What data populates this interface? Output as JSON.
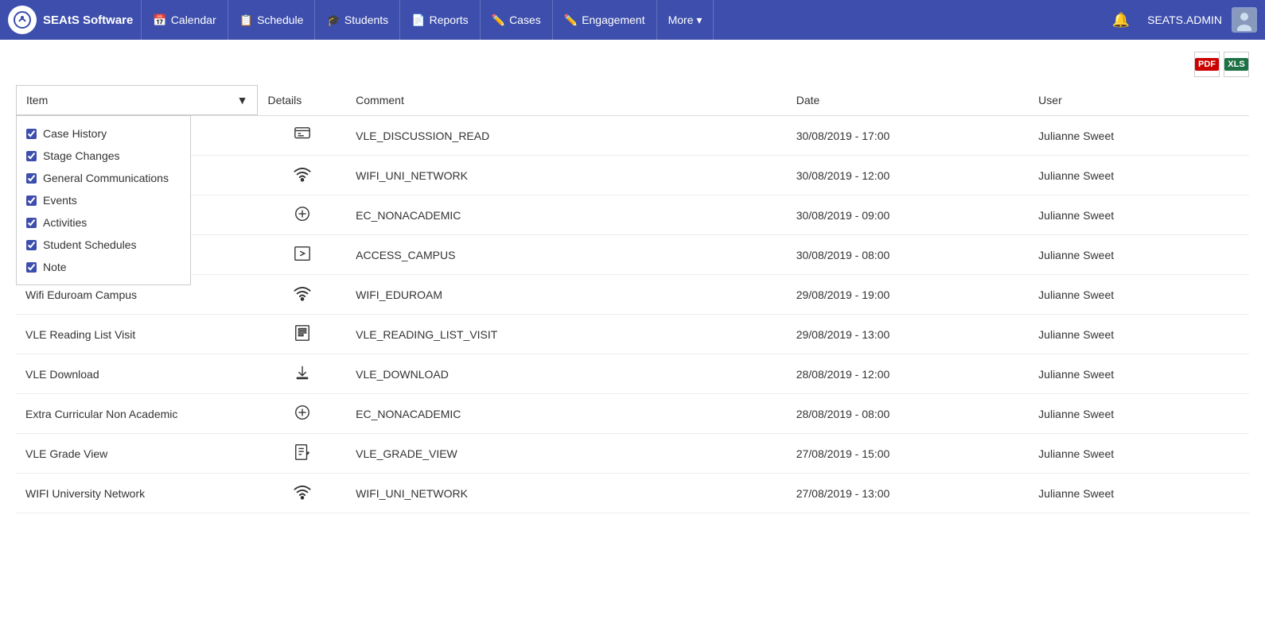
{
  "app": {
    "brand": "SEAtS Software",
    "logo_text": "🎓",
    "admin_name": "SEATS.ADMIN"
  },
  "nav": {
    "items": [
      {
        "label": "Calendar",
        "icon": "📅"
      },
      {
        "label": "Schedule",
        "icon": "📋"
      },
      {
        "label": "Students",
        "icon": "🎓"
      },
      {
        "label": "Reports",
        "icon": "📄"
      },
      {
        "label": "Cases",
        "icon": "✏️"
      },
      {
        "label": "Engagement",
        "icon": "✏️"
      },
      {
        "label": "More ▾",
        "icon": ""
      }
    ]
  },
  "toolbar": {
    "pdf_label": "PDF",
    "excel_label": "XLS"
  },
  "table": {
    "headers": {
      "item": "Item",
      "details": "Details",
      "comment": "Comment",
      "date": "Date",
      "user": "User"
    },
    "dropdown_items": [
      {
        "label": "Case History",
        "checked": true
      },
      {
        "label": "Stage Changes",
        "checked": true
      },
      {
        "label": "General Communications",
        "checked": true
      },
      {
        "label": "Events",
        "checked": true
      },
      {
        "label": "Activities",
        "checked": true
      },
      {
        "label": "Student Schedules",
        "checked": true
      },
      {
        "label": "Note",
        "checked": true
      }
    ],
    "rows": [
      {
        "item": "",
        "icon": "💬",
        "comment": "VLE_DISCUSSION_READ",
        "date": "30/08/2019 - 17:00",
        "user": "Julianne Sweet"
      },
      {
        "item": "",
        "icon": "📶",
        "comment": "WIFI_UNI_NETWORK",
        "date": "30/08/2019 - 12:00",
        "user": "Julianne Sweet"
      },
      {
        "item": "",
        "icon": "⊕",
        "comment": "EC_NONACADEMIC",
        "date": "30/08/2019 - 09:00",
        "user": "Julianne Sweet"
      },
      {
        "item": "",
        "icon": "➡",
        "comment": "ACCESS_CAMPUS",
        "date": "30/08/2019 - 08:00",
        "user": "Julianne Sweet"
      },
      {
        "item": "Wifi Eduroam Campus",
        "icon": "📶",
        "comment": "WIFI_EDUROAM",
        "date": "29/08/2019 - 19:00",
        "user": "Julianne Sweet"
      },
      {
        "item": "VLE Reading List Visit",
        "icon": "📋",
        "comment": "VLE_READING_LIST_VISIT",
        "date": "29/08/2019 - 13:00",
        "user": "Julianne Sweet"
      },
      {
        "item": "VLE Download",
        "icon": "⬇",
        "comment": "VLE_DOWNLOAD",
        "date": "28/08/2019 - 12:00",
        "user": "Julianne Sweet"
      },
      {
        "item": "Extra Curricular Non Academic",
        "icon": "⊕",
        "comment": "EC_NONACADEMIC",
        "date": "28/08/2019 - 08:00",
        "user": "Julianne Sweet"
      },
      {
        "item": "VLE Grade View",
        "icon": "📝",
        "comment": "VLE_GRADE_VIEW",
        "date": "27/08/2019 - 15:00",
        "user": "Julianne Sweet"
      },
      {
        "item": "WIFI University Network",
        "icon": "📶",
        "comment": "WIFI_UNI_NETWORK",
        "date": "27/08/2019 - 13:00",
        "user": "Julianne Sweet"
      }
    ]
  }
}
